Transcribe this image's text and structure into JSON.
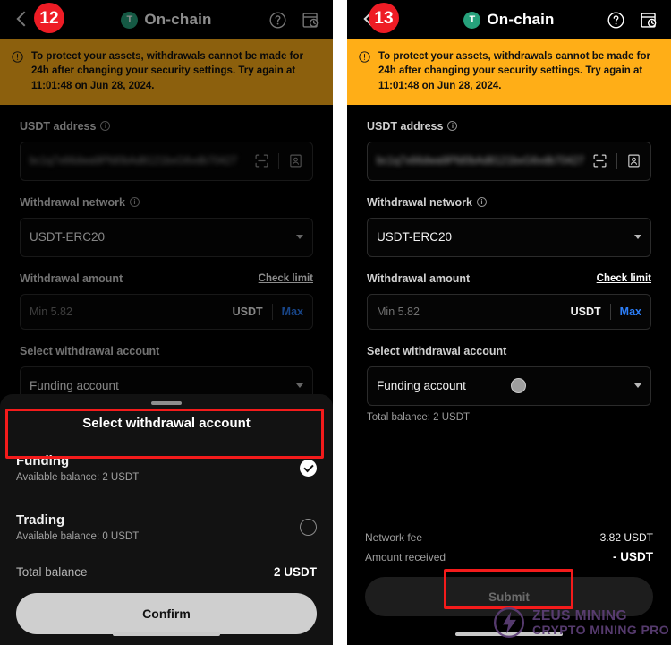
{
  "meta": {
    "screen_title": "On-chain",
    "coin_symbol": "T"
  },
  "annotations": {
    "left_badge": "12",
    "right_badge": "13"
  },
  "navbar": {
    "back_icon": "chevron-left-icon",
    "help_icon": "help-circle-icon",
    "history_icon": "transaction-history-icon"
  },
  "warning": {
    "icon": "alert-circle-icon",
    "text": "To protect your assets, withdrawals cannot be made for 24h after changing your security settings. Try again at 11:01:48 on Jun 28, 2024."
  },
  "form": {
    "address_label": "USDT address",
    "address_value": "bc1q7x66dwa9Pfd0bAd8121bxG6vdb70427",
    "scan_icon": "scan-qr-icon",
    "contacts_icon": "address-book-icon",
    "network_label": "Withdrawal network",
    "network_value": "USDT-ERC20",
    "amount_label": "Withdrawal amount",
    "check_limit_label": "Check limit",
    "amount_placeholder": "Min 5.82",
    "amount_unit": "USDT",
    "max_label": "Max",
    "account_label": "Select withdrawal account",
    "account_value": "Funding account",
    "total_balance_inline": "Total balance: 2 USDT"
  },
  "sheet": {
    "title": "Select withdrawal account",
    "accounts": [
      {
        "name": "Funding",
        "balance": "Available balance: 2 USDT",
        "selected": true
      },
      {
        "name": "Trading",
        "balance": "Available balance: 0 USDT",
        "selected": false
      }
    ],
    "total_label": "Total balance",
    "total_value": "2 USDT",
    "confirm_label": "Confirm"
  },
  "footer": {
    "network_fee_label": "Network fee",
    "network_fee_value": "3.82 USDT",
    "amount_received_label": "Amount received",
    "amount_received_value": "- USDT",
    "submit_label": "Submit"
  },
  "watermark": {
    "line1": "ZEUS MINING",
    "line2": "CRYPTO MINING PRO",
    "icon": "zeus-bolt-logo-icon",
    "color": "#5d3f77"
  },
  "colors": {
    "warning_bg": "#ffae17",
    "accent_blue": "#2c7ef8",
    "annotation_red": "#f41b1b",
    "tether_green": "#26a17b"
  }
}
